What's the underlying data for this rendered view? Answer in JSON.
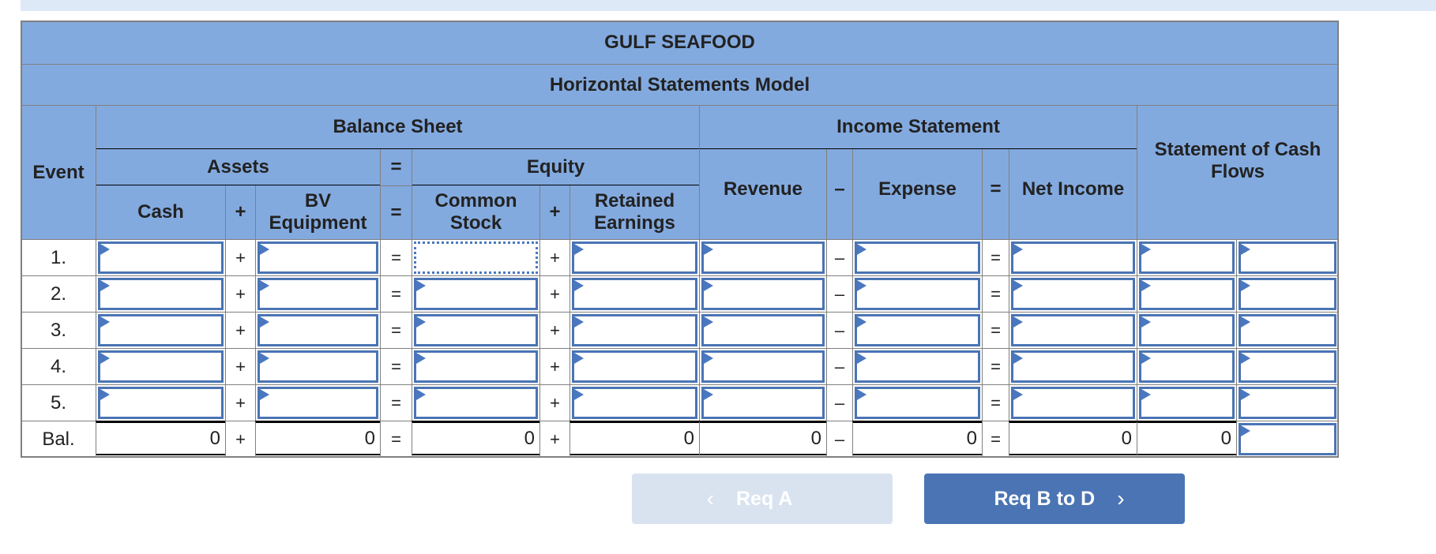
{
  "title": "GULF SEAFOOD",
  "subtitle": "Horizontal Statements Model",
  "headers": {
    "event": "Event",
    "balance_sheet": "Balance Sheet",
    "income_statement": "Income Statement",
    "cash_flows": "Statement of Cash Flows",
    "assets": "Assets",
    "equity": "Equity",
    "cash": "Cash",
    "bv_equipment": "BV Equipment",
    "common_stock": "Common Stock",
    "retained_earnings": "Retained Earnings",
    "revenue": "Revenue",
    "expense": "Expense",
    "net_income": "Net Income",
    "plus": "+",
    "equals": "=",
    "minus": "–"
  },
  "rows": [
    {
      "event": "1.",
      "cash": "",
      "bv_equipment": "",
      "common_stock": "",
      "retained_earnings": "",
      "revenue": "",
      "expense": "",
      "net_income": "",
      "cash_flow_amount": "",
      "cash_flow_type": ""
    },
    {
      "event": "2.",
      "cash": "",
      "bv_equipment": "",
      "common_stock": "",
      "retained_earnings": "",
      "revenue": "",
      "expense": "",
      "net_income": "",
      "cash_flow_amount": "",
      "cash_flow_type": ""
    },
    {
      "event": "3.",
      "cash": "",
      "bv_equipment": "",
      "common_stock": "",
      "retained_earnings": "",
      "revenue": "",
      "expense": "",
      "net_income": "",
      "cash_flow_amount": "",
      "cash_flow_type": ""
    },
    {
      "event": "4.",
      "cash": "",
      "bv_equipment": "",
      "common_stock": "",
      "retained_earnings": "",
      "revenue": "",
      "expense": "",
      "net_income": "",
      "cash_flow_amount": "",
      "cash_flow_type": ""
    },
    {
      "event": "5.",
      "cash": "",
      "bv_equipment": "",
      "common_stock": "",
      "retained_earnings": "",
      "revenue": "",
      "expense": "",
      "net_income": "",
      "cash_flow_amount": "",
      "cash_flow_type": ""
    }
  ],
  "balance_row": {
    "event": "Bal.",
    "cash": "0",
    "bv_equipment": "0",
    "common_stock": "0",
    "retained_earnings": "0",
    "revenue": "0",
    "expense": "0",
    "net_income": "0",
    "cash_flow_amount": "0",
    "cash_flow_type": ""
  },
  "focused_cell": {
    "row": "1.",
    "column": "common_stock"
  },
  "nav": {
    "prev_label": "Req A",
    "prev_icon": "chevron-left-icon",
    "prev_enabled": false,
    "next_label": "Req B to D",
    "next_icon": "chevron-right-icon",
    "next_enabled": true
  },
  "colors": {
    "header_bg": "#83aadf",
    "input_border": "#4a74b4",
    "next_button": "#4a74b4",
    "prev_button_disabled": "#d9e3f0"
  }
}
